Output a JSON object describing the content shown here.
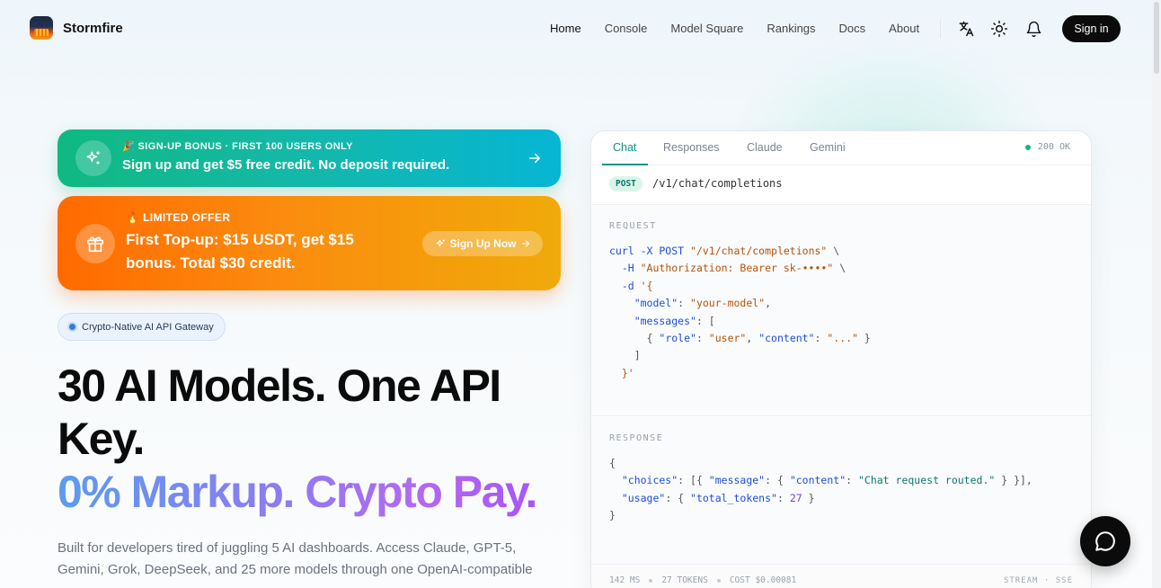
{
  "brand": {
    "name": "Stormfire"
  },
  "nav": {
    "items": [
      {
        "label": "Home",
        "active": true
      },
      {
        "label": "Console"
      },
      {
        "label": "Model Square"
      },
      {
        "label": "Rankings"
      },
      {
        "label": "Docs"
      },
      {
        "label": "About"
      }
    ],
    "icons": [
      "translate-icon",
      "sun-icon",
      "bell-icon"
    ],
    "signin": "Sign in"
  },
  "banner_signup": {
    "kicker": "🎉 SIGN-UP BONUS · FIRST 100 USERS ONLY",
    "title": "Sign up and get $5 free credit. No deposit required.",
    "icon": "sparkles-icon",
    "color_from": "#10b981",
    "color_to": "#06b6d4"
  },
  "banner_offer": {
    "kicker": "🔥 LIMITED OFFER",
    "title": "First Top-up: $15 USDT, get $15 bonus. Total $30 credit.",
    "cta": "Sign Up Now",
    "icon": "gift-icon",
    "color_from": "#ff6a00",
    "color_to": "#f0aa0a"
  },
  "hero": {
    "pill": "Crypto-Native AI API Gateway",
    "headline": "30 AI Models. One API Key.",
    "headline_gradient": "0% Markup. Crypto Pay.",
    "lead": "Built for developers tired of juggling 5 AI dashboards. Access Claude, GPT-5, Gemini, Grok, DeepSeek, and 25 more models through one OpenAI-compatible"
  },
  "code_panel": {
    "tabs": [
      {
        "label": "Chat",
        "active": true
      },
      {
        "label": "Responses"
      },
      {
        "label": "Claude"
      },
      {
        "label": "Gemini"
      }
    ],
    "status": "200 OK",
    "method": "POST",
    "path": "/v1/chat/completions",
    "request_label": "REQUEST",
    "request": {
      "l1_cmd": "curl -X POST ",
      "l1_url": "\"/v1/chat/completions\"",
      "l1_end": " \\",
      "l2_flag": "  -H ",
      "l2_val": "\"Authorization: Bearer sk-••••\"",
      "l2_end": " \\",
      "l3_flag": "  -d ",
      "l3_val": "'{",
      "l4_key": "    \"model\"",
      "l4_sep": ": ",
      "l4_val": "\"your-model\"",
      "l4_end": ",",
      "l5_key": "    \"messages\"",
      "l5_end": ": [",
      "l6_a": "      { ",
      "l6_k1": "\"role\"",
      "l6_c1": ": ",
      "l6_v1": "\"user\"",
      "l6_sep": ", ",
      "l6_k2": "\"content\"",
      "l6_c2": ": ",
      "l6_v2": "\"...\"",
      "l6_end": " }",
      "l7": "    ]",
      "l8": "  }'"
    },
    "response_label": "RESPONSE",
    "response": {
      "l1": "{",
      "l2_k1": "  \"choices\"",
      "l2_a": ": [{ ",
      "l2_k2": "\"message\"",
      "l2_b": ": { ",
      "l2_k3": "\"content\"",
      "l2_c": ": ",
      "l2_v": "\"Chat request routed.\"",
      "l2_end": " } }],",
      "l3_k1": "  \"usage\"",
      "l3_a": ": { ",
      "l3_k2": "\"total_tokens\"",
      "l3_b": ": ",
      "l3_v": "27",
      "l3_end": " }",
      "l4": "}"
    },
    "footer": {
      "latency": "142 MS",
      "tokens": "27 TOKENS",
      "cost_label": "COST",
      "cost_value": "$0.00081",
      "mode": "STREAM · SSE"
    }
  },
  "chat_fab": {
    "icon": "chat-bubble-icon"
  }
}
